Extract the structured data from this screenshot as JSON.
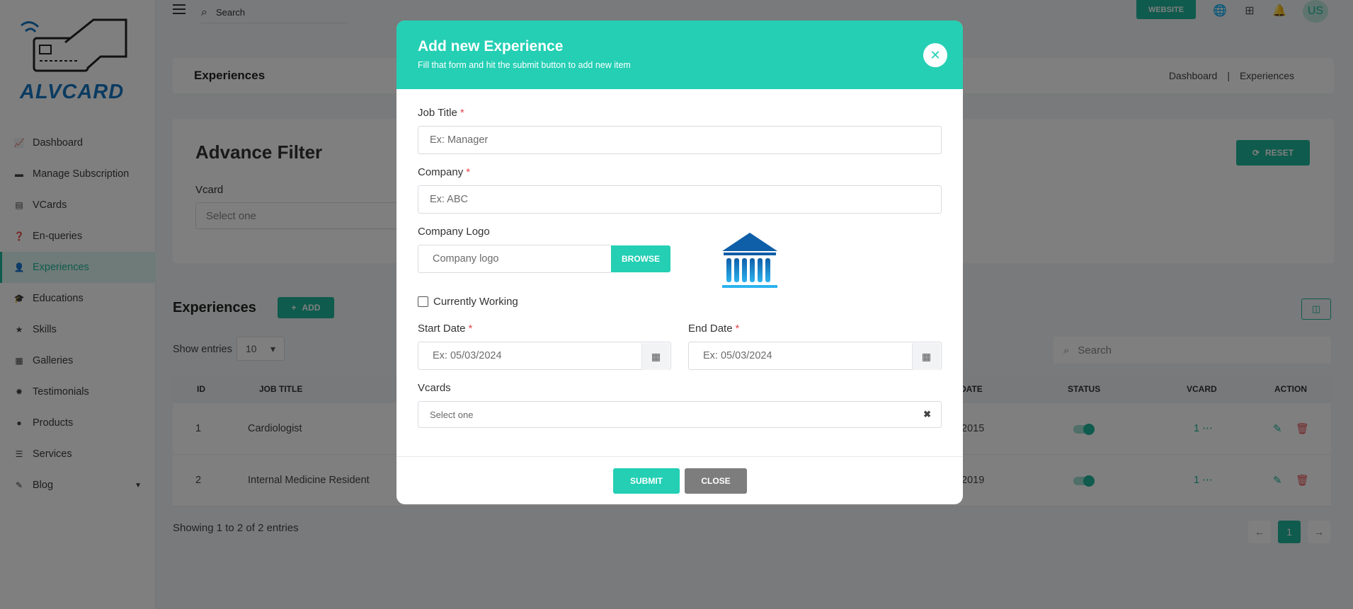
{
  "brand": {
    "name": "ALVCARD"
  },
  "sidebar": {
    "items": [
      {
        "label": "Dashboard",
        "icon": "chart-line-icon"
      },
      {
        "label": "Manage Subscription",
        "icon": "card-icon"
      },
      {
        "label": "VCards",
        "icon": "id-card-icon"
      },
      {
        "label": "En-queries",
        "icon": "question-icon"
      },
      {
        "label": "Experiences",
        "icon": "user-tie-icon",
        "active": true
      },
      {
        "label": "Educations",
        "icon": "graduation-icon"
      },
      {
        "label": "Skills",
        "icon": "star-icon"
      },
      {
        "label": "Galleries",
        "icon": "gallery-icon"
      },
      {
        "label": "Testimonials",
        "icon": "badge-icon"
      },
      {
        "label": "Products",
        "icon": "product-icon"
      },
      {
        "label": "Services",
        "icon": "list-icon"
      },
      {
        "label": "Blog",
        "icon": "blog-icon"
      }
    ]
  },
  "topbar": {
    "search_placeholder": "Search",
    "website_label": "WEBSITE",
    "avatar_initials": "US"
  },
  "page": {
    "title": "Experiences",
    "breadcrumb": [
      "Dashboard",
      "|",
      "Experiences"
    ]
  },
  "filter": {
    "title": "Advance Filter",
    "vcard_label": "Vcard",
    "vcard_placeholder": "Select one",
    "reset_label": "RESET"
  },
  "list": {
    "title": "Experiences",
    "add_label": "ADD",
    "show_entries_label": "Show entries",
    "entries_value": "10",
    "search_placeholder": "Search",
    "columns": [
      "ID",
      "JOB TITLE",
      "DATE",
      "STATUS",
      "VCARD",
      "ACTION"
    ],
    "rows": [
      {
        "id": "1",
        "job_title": "Cardiologist",
        "date": "2015",
        "vcard": "1"
      },
      {
        "id": "2",
        "job_title": "Internal Medicine Resident",
        "date": "2019",
        "vcard": "1"
      }
    ],
    "showing_text": "Showing 1 to 2 of 2 entries",
    "pagination": {
      "prev": "←",
      "current": "1",
      "next": "→"
    }
  },
  "modal": {
    "title": "Add new Experience",
    "subtitle": "Fill that form and hit the submit button to add new item",
    "job_title_label": "Job Title",
    "job_title_placeholder": "Ex: Manager",
    "company_label": "Company",
    "company_placeholder": "Ex: ABC",
    "logo_label": "Company Logo",
    "logo_placeholder": "Company logo",
    "browse_label": "BROWSE",
    "currently_working_label": "Currently Working",
    "start_date_label": "Start Date",
    "start_date_placeholder": "Ex: 05/03/2024",
    "end_date_label": "End Date",
    "end_date_placeholder": "Ex: 05/03/2024",
    "vcards_label": "Vcards",
    "vcards_placeholder": "Select one",
    "required_mark": "*",
    "submit_label": "SUBMIT",
    "close_label": "CLOSE"
  },
  "colors": {
    "accent": "#1fb79a",
    "modal_header": "#24cfb4",
    "danger": "#e5484d",
    "logo_blue": "#1576c2"
  }
}
